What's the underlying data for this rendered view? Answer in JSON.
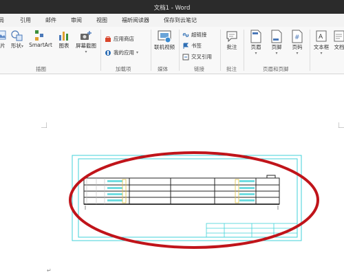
{
  "window": {
    "title": "文档1 - Word"
  },
  "tabs": [
    "局",
    "引用",
    "邮件",
    "审阅",
    "视图",
    "福昕阅读器",
    "保存到云笔记"
  ],
  "ribbon": {
    "illustrations": {
      "picture_label": "片",
      "shapes_label": "形状",
      "smartart_label": "SmartArt",
      "chart_label": "图表",
      "screenshot_label": "屏幕截图",
      "group_label": "插图"
    },
    "addins": {
      "store_label": "应用商店",
      "myapps_label": "我的应用",
      "group_label": "加载项"
    },
    "media": {
      "online_video_label": "联机视频",
      "group_label": "媒体"
    },
    "links": {
      "hyperlink_label": "超链接",
      "bookmark_label": "书签",
      "crossref_label": "交叉引用",
      "group_label": "链接"
    },
    "comments": {
      "comment_label": "批注",
      "group_label": "批注"
    },
    "header_footer": {
      "header_label": "页眉",
      "footer_label": "页脚",
      "page_number_label": "页码",
      "group_label": "页眉和页脚"
    },
    "text": {
      "textbox_label": "文本框",
      "docparts_label": "文档"
    }
  },
  "document": {
    "paragraph_mark": "↵"
  },
  "colors": {
    "titlebar": "#2b2b2b",
    "drawing_cyan": "#3fd2d8",
    "annotation_red": "#c0141a"
  }
}
